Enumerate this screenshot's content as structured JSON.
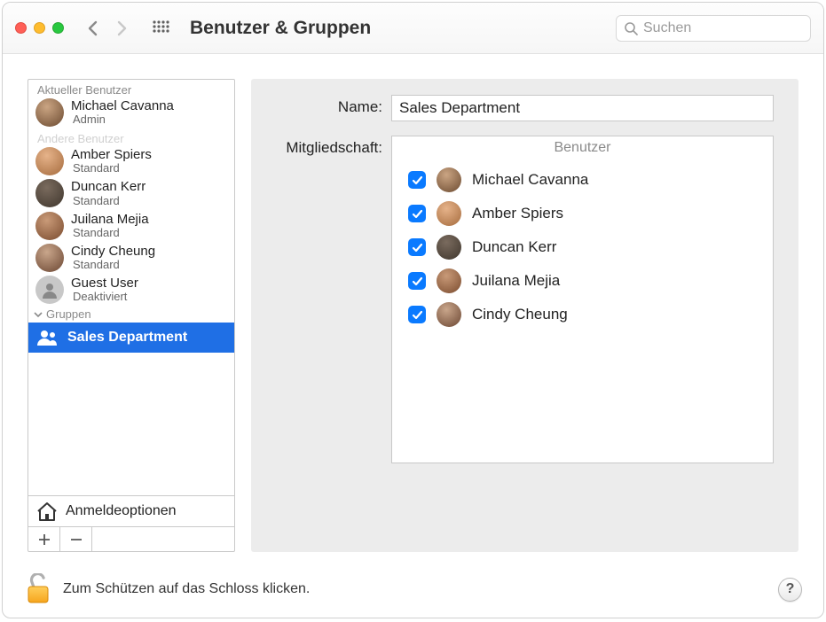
{
  "window": {
    "title": "Benutzer & Gruppen"
  },
  "search": {
    "placeholder": "Suchen"
  },
  "sidebar": {
    "current_header": "Aktueller Benutzer",
    "others_header": "Andere Benutzer",
    "groups_header": "Gruppen",
    "current": {
      "name": "Michael Cavanna",
      "role": "Admin"
    },
    "others": [
      {
        "name": "Amber Spiers",
        "role": "Standard"
      },
      {
        "name": "Duncan Kerr",
        "role": "Standard"
      },
      {
        "name": "Juilana Mejia",
        "role": "Standard"
      },
      {
        "name": "Cindy Cheung",
        "role": "Standard"
      },
      {
        "name": "Guest User",
        "role": "Deaktiviert"
      }
    ],
    "groups": [
      {
        "name": "Sales Department",
        "selected": true
      }
    ],
    "login_options": "Anmeldeoptionen"
  },
  "detail": {
    "name_label": "Name:",
    "name_value": "Sales Department",
    "membership_label": "Mitgliedschaft:",
    "membership_header": "Benutzer",
    "members": [
      {
        "name": "Michael Cavanna",
        "checked": true
      },
      {
        "name": "Amber Spiers",
        "checked": true
      },
      {
        "name": "Duncan Kerr",
        "checked": true
      },
      {
        "name": "Juilana Mejia",
        "checked": true
      },
      {
        "name": "Cindy Cheung",
        "checked": true
      }
    ]
  },
  "footer": {
    "lock_text": "Zum Schützen auf das Schloss klicken.",
    "help": "?"
  }
}
